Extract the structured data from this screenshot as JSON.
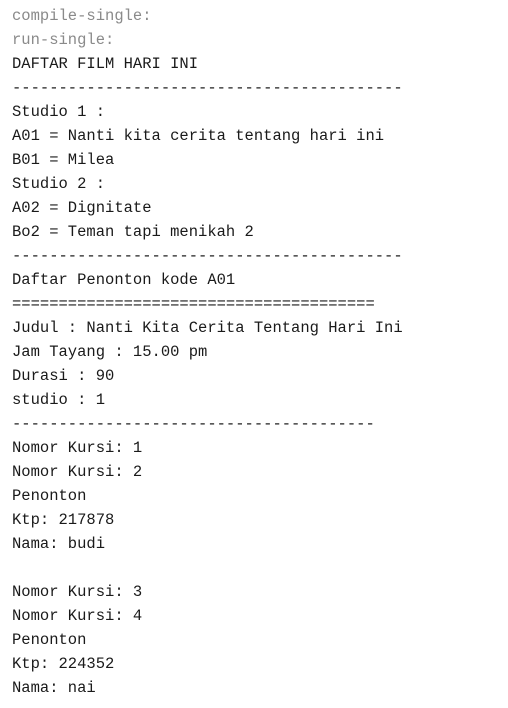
{
  "console": {
    "lines": [
      {
        "text": "compile-single:",
        "style": "muted"
      },
      {
        "text": "run-single:",
        "style": "muted"
      },
      {
        "text": "DAFTAR FILM HARI INI",
        "style": "normal"
      },
      {
        "text": "------------------------------------------",
        "style": "normal"
      },
      {
        "text": "Studio 1 :",
        "style": "normal"
      },
      {
        "text": "A01 = Nanti kita cerita tentang hari ini",
        "style": "normal"
      },
      {
        "text": "B01 = Milea",
        "style": "normal"
      },
      {
        "text": "Studio 2 :",
        "style": "normal"
      },
      {
        "text": "A02 = Dignitate",
        "style": "normal"
      },
      {
        "text": "Bo2 = Teman tapi menikah 2",
        "style": "normal"
      },
      {
        "text": "------------------------------------------",
        "style": "normal"
      },
      {
        "text": "Daftar Penonton kode A01",
        "style": "normal"
      },
      {
        "text": "=======================================",
        "style": "normal"
      },
      {
        "text": "Judul : Nanti Kita Cerita Tentang Hari Ini",
        "style": "normal"
      },
      {
        "text": "Jam Tayang : 15.00 pm",
        "style": "normal"
      },
      {
        "text": "Durasi : 90",
        "style": "normal"
      },
      {
        "text": "studio : 1",
        "style": "normal"
      },
      {
        "text": "---------------------------------------",
        "style": "normal"
      },
      {
        "text": "Nomor Kursi: 1",
        "style": "normal"
      },
      {
        "text": "Nomor Kursi: 2",
        "style": "normal"
      },
      {
        "text": "Penonton",
        "style": "normal"
      },
      {
        "text": "Ktp: 217878",
        "style": "normal"
      },
      {
        "text": "Nama: budi",
        "style": "normal"
      },
      {
        "text": "",
        "style": "normal"
      },
      {
        "text": "Nomor Kursi: 3",
        "style": "normal"
      },
      {
        "text": "Nomor Kursi: 4",
        "style": "normal"
      },
      {
        "text": "Penonton",
        "style": "normal"
      },
      {
        "text": "Ktp: 224352",
        "style": "normal"
      },
      {
        "text": "Nama: nai",
        "style": "normal"
      }
    ]
  }
}
